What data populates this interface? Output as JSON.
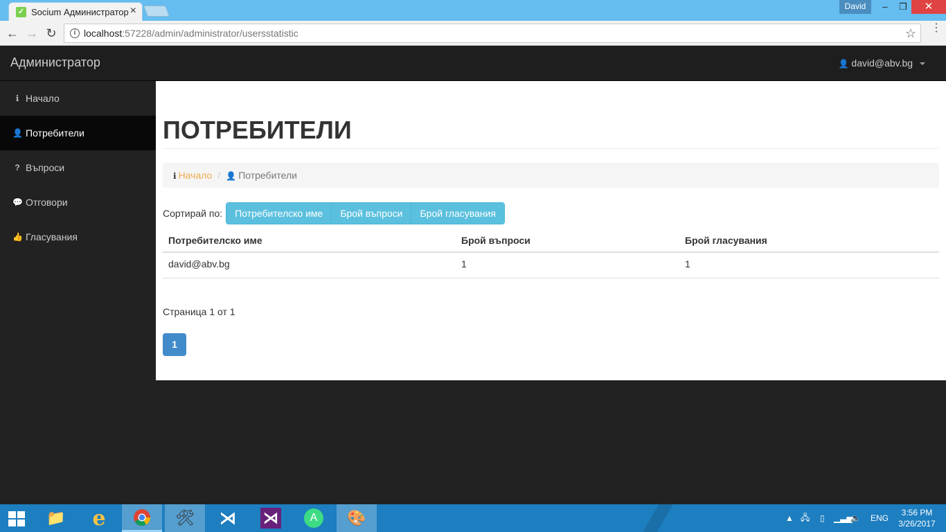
{
  "browser": {
    "tab_title": "Socium Администратор",
    "profile_name": "David",
    "url_host": "localhost",
    "url_rest": ":57228/admin/administrator/usersstatistic"
  },
  "app": {
    "brand": "Администратор",
    "user_email": "david@abv.bg"
  },
  "sidebar": {
    "items": [
      {
        "label": "Начало",
        "icon": "info-circle-icon"
      },
      {
        "label": "Потребители",
        "icon": "user-icon"
      },
      {
        "label": "Въпроси",
        "icon": "question-icon"
      },
      {
        "label": "Отговори",
        "icon": "comments-icon"
      },
      {
        "label": "Гласувания",
        "icon": "thumbs-up-icon"
      }
    ]
  },
  "page": {
    "title": "ПОТРЕБИТЕЛИ",
    "breadcrumb": {
      "home": "Начало",
      "current": "Потребители"
    },
    "sort_label": "Сортирай по:",
    "sort_buttons": [
      "Потребителско име",
      "Брой въпроси",
      "Брой гласувания"
    ],
    "table": {
      "headers": [
        "Потребителско име",
        "Брой въпроси",
        "Брой гласувания"
      ],
      "rows": [
        [
          "david@abv.bg",
          "1",
          "1"
        ]
      ]
    },
    "pagination_text": "Страница 1 от 1",
    "page_number": "1"
  },
  "taskbar": {
    "lang": "ENG",
    "time": "3:56 PM",
    "date": "3/26/2017"
  },
  "colors": {
    "accent_link": "#f0ad4e",
    "button_info": "#5bc0de",
    "page_primary": "#428bca",
    "navbar": "#1e1e1e"
  }
}
